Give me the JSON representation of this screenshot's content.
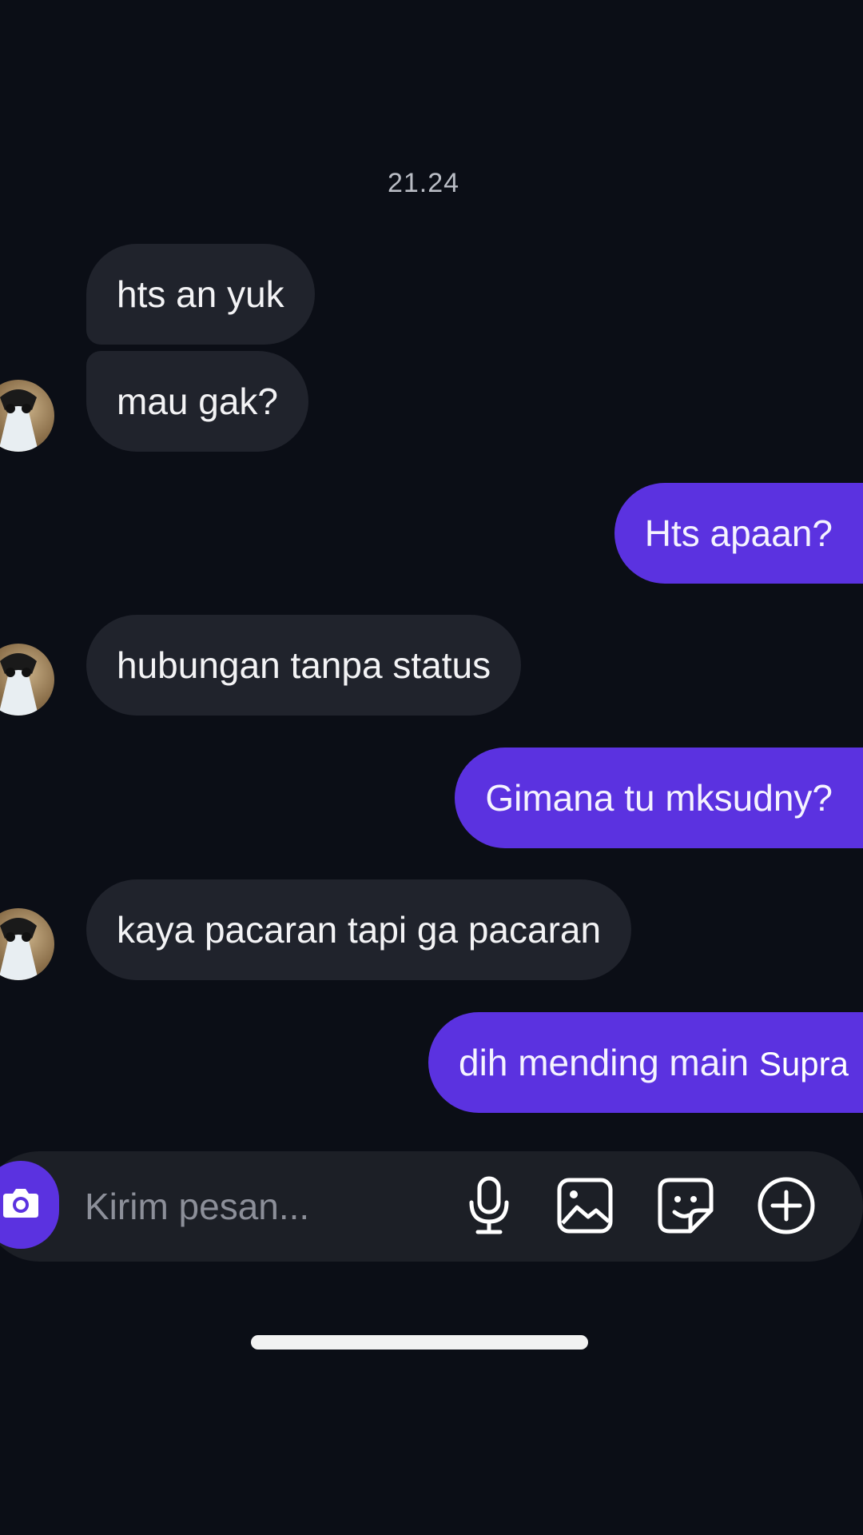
{
  "chat": {
    "timestamp": "21.24",
    "messages": [
      {
        "from": "them",
        "text": "hts an yuk"
      },
      {
        "from": "them",
        "text": "mau gak?"
      },
      {
        "from": "me",
        "text": "Hts apaan?"
      },
      {
        "from": "them",
        "text": "hubungan tanpa status"
      },
      {
        "from": "me",
        "text": "Gimana tu mksudny?"
      },
      {
        "from": "them",
        "text": "kaya pacaran tapi ga pacaran"
      },
      {
        "from": "me",
        "text": "dih mending main ",
        "highlight": "Supra"
      }
    ]
  },
  "composer": {
    "placeholder": "Kirim pesan...",
    "icons": [
      "camera-icon",
      "microphone-icon",
      "image-icon",
      "sticker-icon",
      "plus-circle-icon"
    ]
  },
  "colors": {
    "background": "#0b0e16",
    "incoming_bubble": "#20232c",
    "outgoing_bubble": "#5b32e0",
    "composer_bg": "#1c1f26"
  }
}
